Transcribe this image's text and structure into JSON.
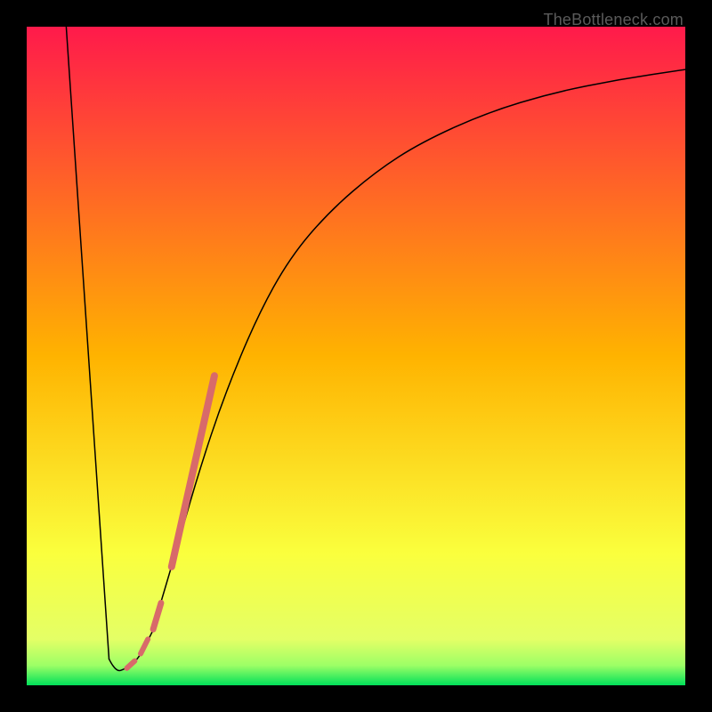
{
  "watermark": "TheBottleneck.com",
  "chart_data": {
    "type": "line",
    "title": "",
    "xlabel": "",
    "ylabel": "",
    "xlim": [
      0,
      100
    ],
    "ylim": [
      0,
      100
    ],
    "background_gradient": {
      "stops": [
        {
          "offset": 0.0,
          "color": "#ff1a4b"
        },
        {
          "offset": 0.5,
          "color": "#ffb300"
        },
        {
          "offset": 0.8,
          "color": "#faff3d"
        },
        {
          "offset": 0.93,
          "color": "#e4ff66"
        },
        {
          "offset": 0.97,
          "color": "#9cff66"
        },
        {
          "offset": 1.0,
          "color": "#00e05a"
        }
      ]
    },
    "series": [
      {
        "name": "left-descent",
        "x": [
          6,
          12.5
        ],
        "y": [
          100,
          4
        ],
        "stroke": "#000000",
        "width": 1.5
      },
      {
        "name": "valley",
        "x": [
          12.5,
          13.5,
          15,
          17,
          19
        ],
        "y": [
          4,
          2,
          2.5,
          4,
          8
        ],
        "stroke": "#000000",
        "width": 1.5
      },
      {
        "name": "right-ascent",
        "x": [
          19,
          22,
          26,
          30,
          35,
          40,
          46,
          53,
          60,
          70,
          80,
          90,
          100
        ],
        "y": [
          8,
          18,
          32,
          44,
          56,
          65,
          72,
          78,
          82.5,
          87,
          90,
          92,
          93.5
        ],
        "stroke": "#000000",
        "width": 1.5
      },
      {
        "name": "pink-dash-upper",
        "x": [
          22,
          28.5
        ],
        "y": [
          18,
          47
        ],
        "stroke": "#d86a6a",
        "width": 8
      },
      {
        "name": "pink-dash-mid",
        "x": [
          19.2,
          20.4
        ],
        "y": [
          8.5,
          12.5
        ],
        "stroke": "#d86a6a",
        "width": 7
      },
      {
        "name": "pink-dash-low1",
        "x": [
          17.3,
          18.4
        ],
        "y": [
          4.8,
          7
        ],
        "stroke": "#d86a6a",
        "width": 6
      },
      {
        "name": "pink-dash-low2",
        "x": [
          15.2,
          16.4
        ],
        "y": [
          2.6,
          3.7
        ],
        "stroke": "#d86a6a",
        "width": 6
      }
    ]
  }
}
